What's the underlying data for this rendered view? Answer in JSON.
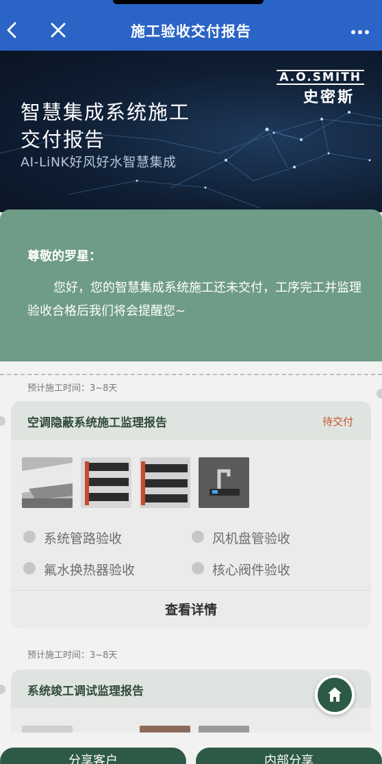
{
  "nav": {
    "title": "施工验收交付报告"
  },
  "banner": {
    "brand_en": "A.O.SMITH",
    "brand_cn": "史密斯",
    "title_line1": "智慧集成系统施工",
    "title_line2": "交付报告",
    "subtitle": "AI-LiNK好风好水智慧集成"
  },
  "greeting": {
    "name": "尊敬的罗星：",
    "message": "您好，您的智慧集成系统施工还未交付，工序完工并监理验收合格后我们将会提醒您~"
  },
  "reports": [
    {
      "estimate": "预计施工时间：3~8天",
      "title": "空调隐蔽系统施工监理报告",
      "status": "待交付",
      "checks": [
        "系统管路验收",
        "风机盘管验收",
        "氟水换热器验收",
        "核心阀件验收"
      ],
      "detail": "查看详情"
    },
    {
      "estimate": "预计施工时间：3~8天",
      "title": "系统竣工调试监理报告"
    }
  ],
  "bottom": {
    "share_customer": "分享客户",
    "internal_share": "内部分享"
  },
  "colors": {
    "nav": "#2a64c6",
    "greeting_card": "#6f9c86",
    "primary_green": "#2d5a46",
    "status": "#c8502a"
  },
  "icons": {
    "back": "chevron-left-icon",
    "close": "close-icon",
    "more": "more-icon",
    "home": "home-icon"
  }
}
